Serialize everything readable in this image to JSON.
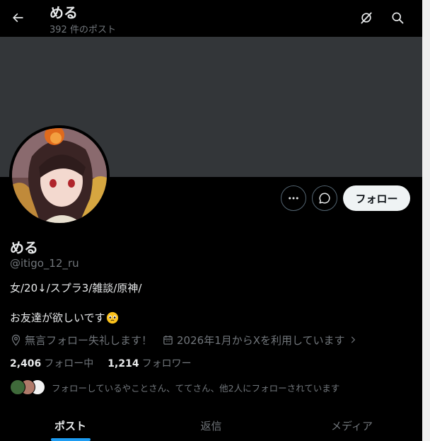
{
  "header": {
    "name": "める",
    "post_count": "392 件のポスト",
    "back_icon": "arrow-left-icon",
    "grok_icon": "grok-icon",
    "search_icon": "search-icon"
  },
  "profile": {
    "display_name": "める",
    "handle": "@itigo_12_ru",
    "bio_line1": "女/20↓/スプラ3/雑談/原神/",
    "bio_line2": "お友達が欲しいです",
    "bio_emoji": "pleading-face-emoji",
    "location": "無言フォロー失礼します！",
    "joined": "2026年1月からXを利用しています",
    "following_count": "2,406",
    "following_label": "フォロー中",
    "followers_count": "1,214",
    "followers_label": "フォロワー",
    "followed_by": "フォローしているやことさん、ててさん、他2人にフォローされています"
  },
  "actions": {
    "more_icon": "more-icon",
    "message_icon": "message-icon",
    "follow_label": "フォロー"
  },
  "tabs": [
    {
      "label": "ポスト",
      "active": true
    },
    {
      "label": "返信",
      "active": false
    },
    {
      "label": "メディア",
      "active": false
    }
  ],
  "colors": {
    "background": "#000000",
    "banner": "#333639",
    "accent": "#1d9bf0",
    "secondary_text": "#71767b"
  }
}
